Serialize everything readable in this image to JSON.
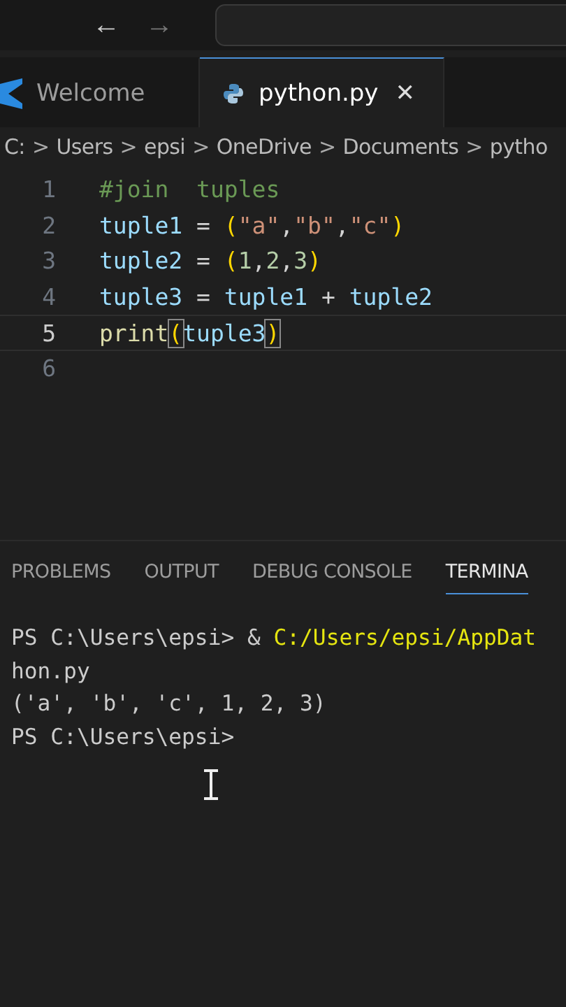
{
  "toolbar": {
    "back": "←",
    "forward": "→"
  },
  "tabs": [
    {
      "label": "Welcome",
      "selected": false
    },
    {
      "label": "python.py",
      "selected": true
    }
  ],
  "tab_close": "✕",
  "breadcrumb": [
    "C:",
    "Users",
    "epsi",
    "OneDrive",
    "Documents",
    "pytho"
  ],
  "breadcrumb_separator": ">",
  "editor": {
    "lines": [
      {
        "number": "1",
        "current": false,
        "tokens": [
          {
            "text": "#join  tuples",
            "kind": "comment"
          }
        ]
      },
      {
        "number": "2",
        "current": false,
        "tokens": [
          {
            "text": "tuple1",
            "kind": "var"
          },
          {
            "text": " = ",
            "kind": "op"
          },
          {
            "text": "(",
            "kind": "paren"
          },
          {
            "text": "\"a\"",
            "kind": "string"
          },
          {
            "text": ",",
            "kind": "op"
          },
          {
            "text": "\"b\"",
            "kind": "string"
          },
          {
            "text": ",",
            "kind": "op"
          },
          {
            "text": "\"c\"",
            "kind": "string"
          },
          {
            "text": ")",
            "kind": "paren"
          }
        ]
      },
      {
        "number": "3",
        "current": false,
        "tokens": [
          {
            "text": "tuple2",
            "kind": "var"
          },
          {
            "text": " = ",
            "kind": "op"
          },
          {
            "text": "(",
            "kind": "paren"
          },
          {
            "text": "1",
            "kind": "number"
          },
          {
            "text": ",",
            "kind": "op"
          },
          {
            "text": "2",
            "kind": "number"
          },
          {
            "text": ",",
            "kind": "op"
          },
          {
            "text": "3",
            "kind": "number"
          },
          {
            "text": ")",
            "kind": "paren"
          }
        ]
      },
      {
        "number": "4",
        "current": false,
        "tokens": [
          {
            "text": "tuple3",
            "kind": "var"
          },
          {
            "text": " = ",
            "kind": "op"
          },
          {
            "text": "tuple1",
            "kind": "var"
          },
          {
            "text": " + ",
            "kind": "op"
          },
          {
            "text": "tuple2",
            "kind": "var"
          }
        ]
      },
      {
        "number": "5",
        "current": true,
        "tokens": [
          {
            "text": "print",
            "kind": "func"
          },
          {
            "text": "(",
            "kind": "match"
          },
          {
            "text": "tuple3",
            "kind": "var"
          },
          {
            "text": ")",
            "kind": "match"
          }
        ]
      },
      {
        "number": "6",
        "current": false
      }
    ]
  },
  "panel_tabs": [
    {
      "label": "PROBLEMS",
      "selected": false
    },
    {
      "label": "OUTPUT",
      "selected": false
    },
    {
      "label": "DEBUG CONSOLE",
      "selected": false
    },
    {
      "label": "TERMINA",
      "selected": true
    }
  ],
  "terminal": {
    "lines": [
      [
        {
          "text": "PS C:\\Users\\epsi> & ",
          "kind": "plain"
        },
        {
          "text": "C:/Users/epsi/AppDat",
          "kind": "path"
        }
      ],
      [
        {
          "text": "hon.py",
          "kind": "plain"
        }
      ],
      [
        {
          "text": "('a', 'b', 'c', 1, 2, 3)",
          "kind": "plain"
        }
      ],
      [
        {
          "text": "PS C:\\Users\\epsi>",
          "kind": "plain"
        }
      ]
    ]
  }
}
